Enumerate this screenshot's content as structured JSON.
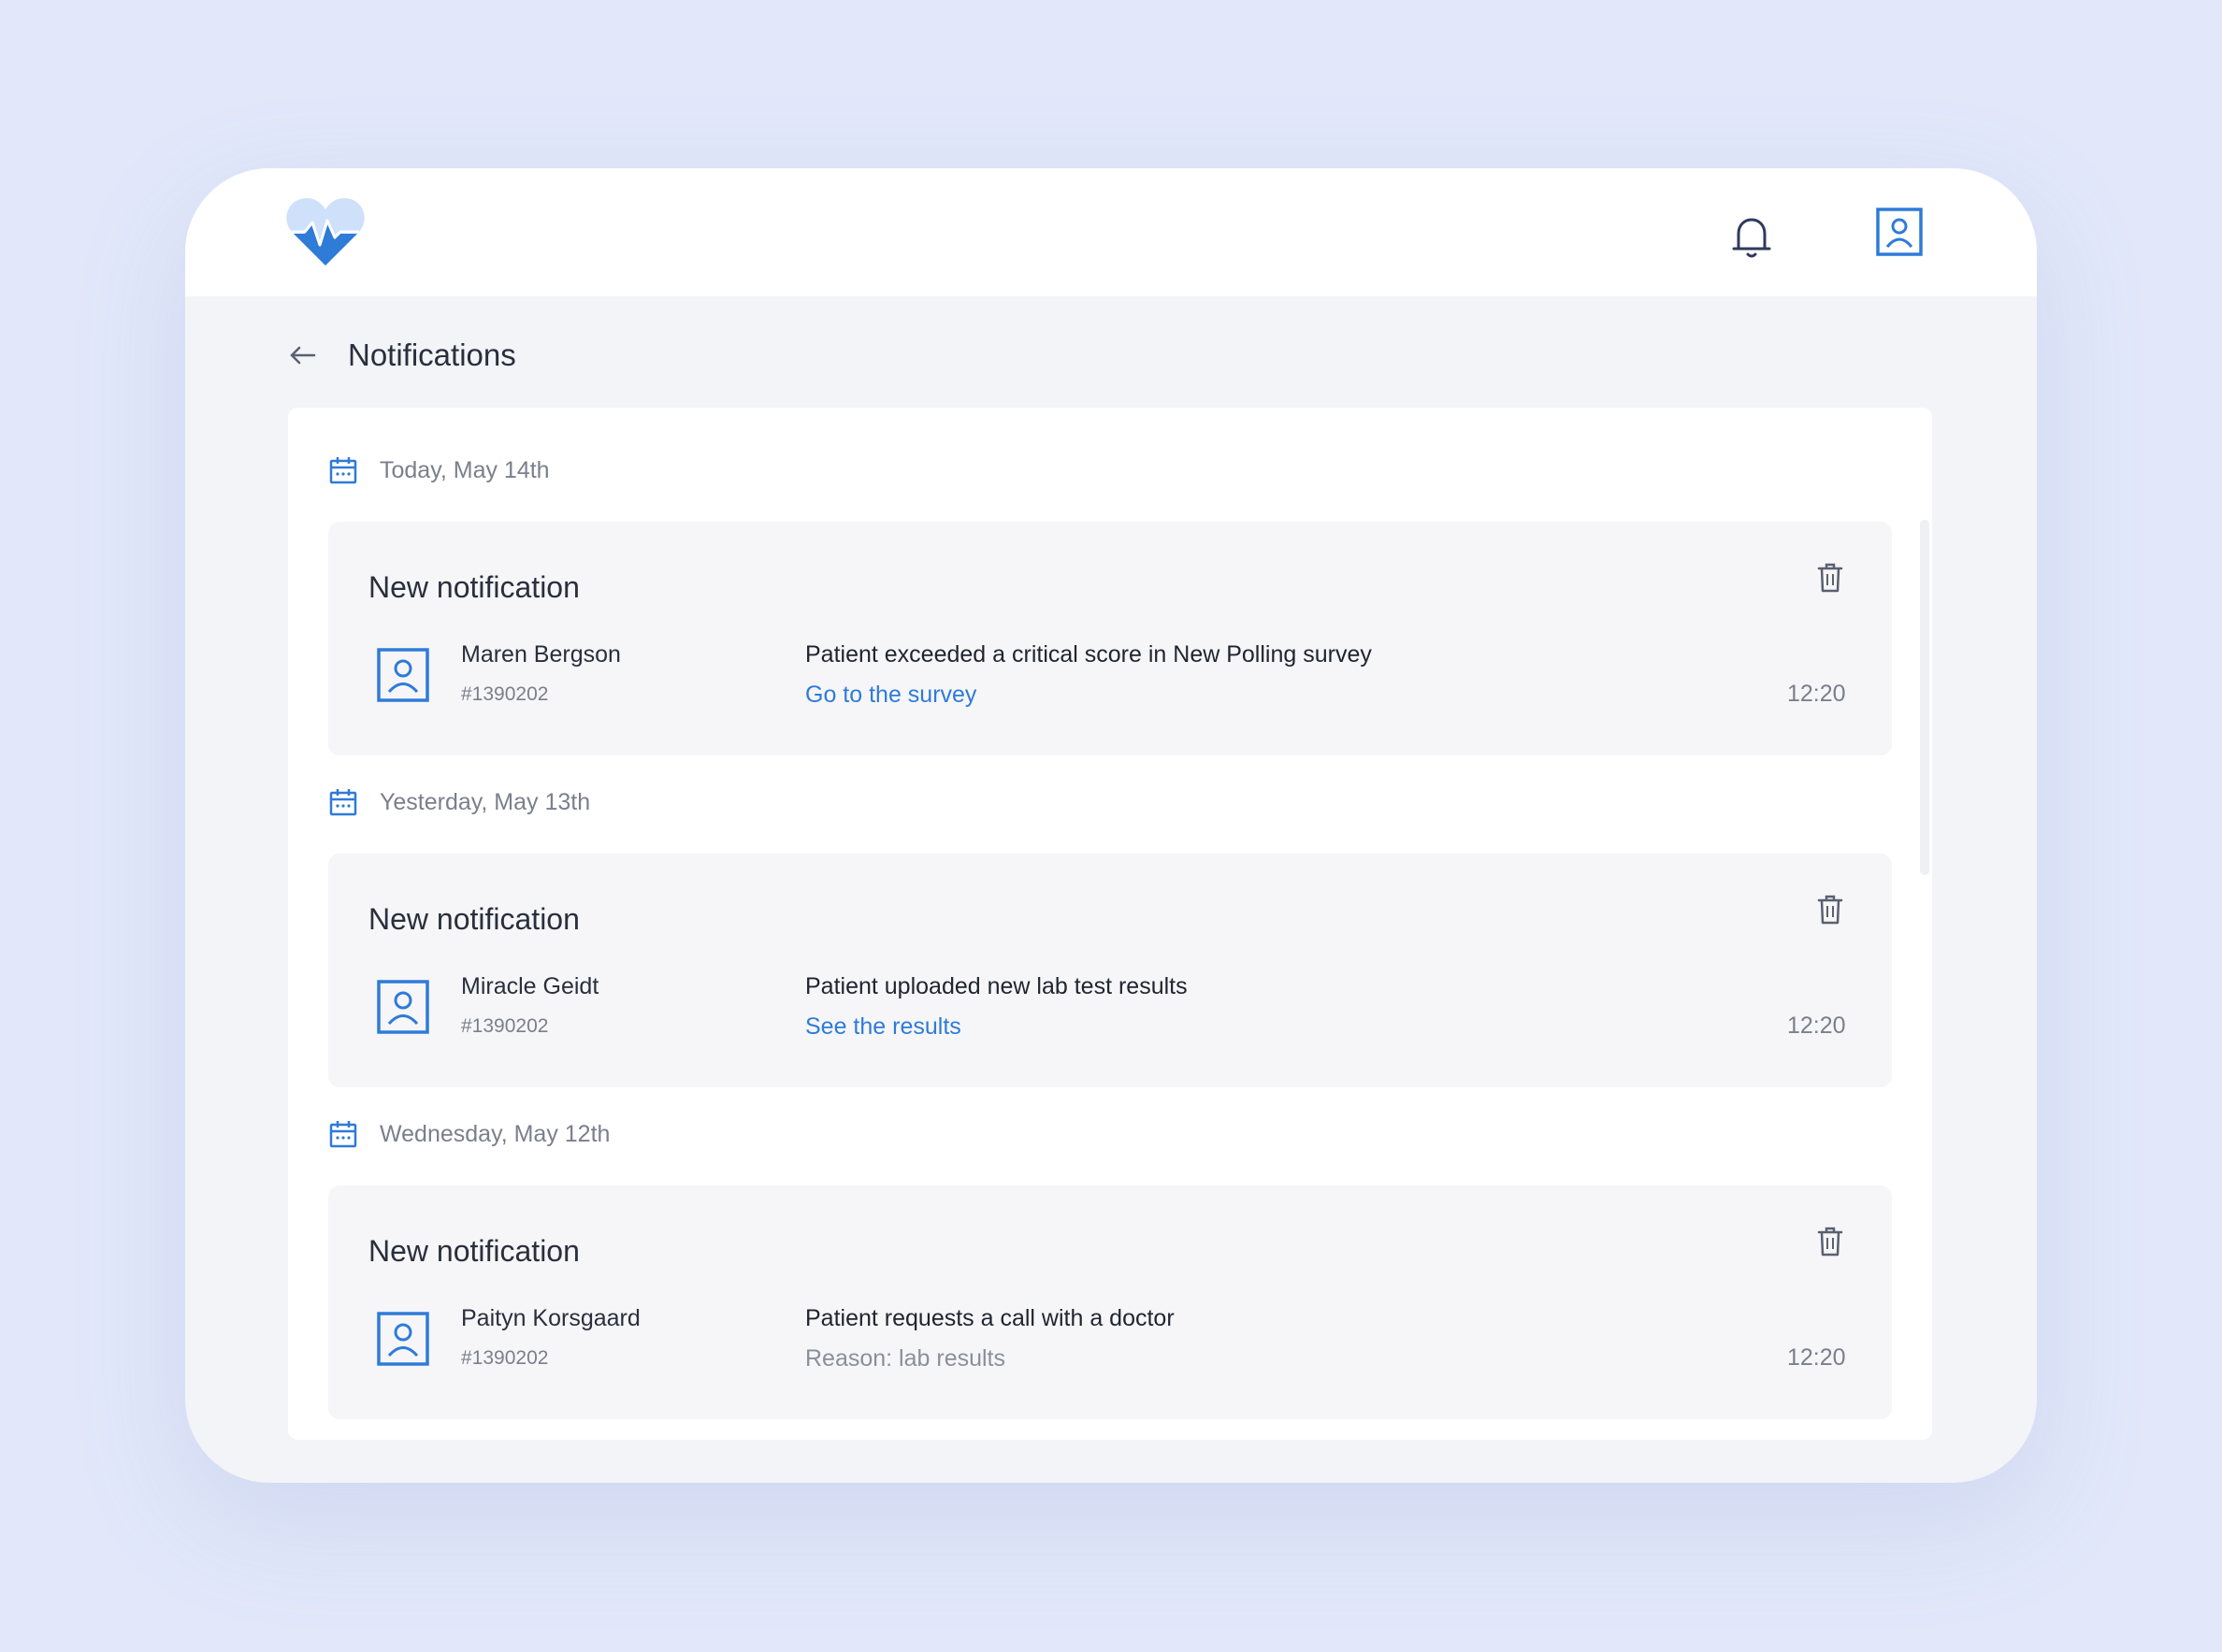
{
  "header": {
    "logo_icon": "heart-pulse-logo-icon",
    "bell_icon": "bell-icon",
    "profile_icon": "user-profile-icon"
  },
  "page": {
    "title": "Notifications",
    "back_icon": "arrow-left-icon"
  },
  "groups": [
    {
      "date": "Today, May 14th",
      "notification": {
        "title": "New notification",
        "patient_name": "Maren Bergson",
        "patient_id": "#1390202",
        "message": "Patient exceeded a critical score in New Polling survey",
        "action": "Go to the survey",
        "time": "12:20"
      }
    },
    {
      "date": "Yesterday, May 13th",
      "notification": {
        "title": "New notification",
        "patient_name": "Miracle Geidt",
        "patient_id": "#1390202",
        "message": "Patient uploaded new lab test results",
        "action": "See the results",
        "time": "12:20"
      }
    },
    {
      "date": "Wednesday, May 12th",
      "notification": {
        "title": "New notification",
        "patient_name": "Paityn Korsgaard",
        "patient_id": "#1390202",
        "message": "Patient requests a call with a doctor",
        "reason": "Reason: lab results",
        "time": "12:20"
      }
    }
  ],
  "colors": {
    "background": "#e2e8fa",
    "accent": "#2e7bd8",
    "text": "#2a2f3d",
    "muted": "#7a7f8c"
  }
}
